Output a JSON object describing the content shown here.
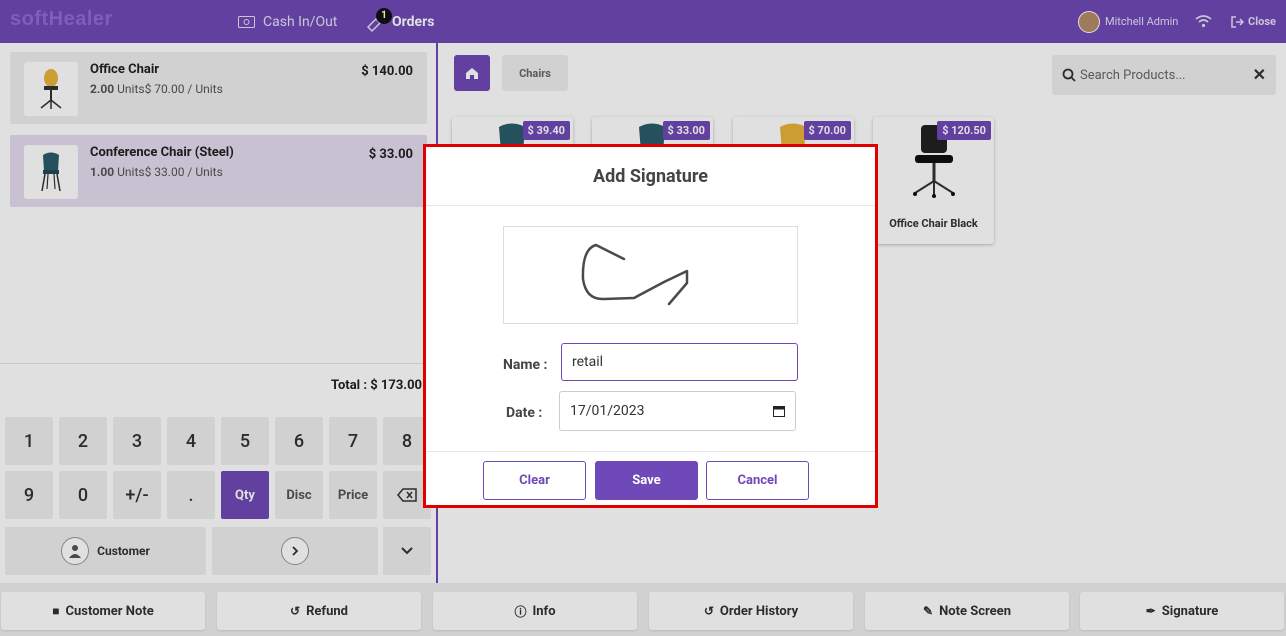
{
  "topbar": {
    "logo": "softHealer",
    "cash_label": "Cash In/Out",
    "orders_label": "Orders",
    "orders_count": "1",
    "user_name": "Mitchell Admin",
    "close_label": "Close"
  },
  "order": {
    "lines": [
      {
        "name": "Office Chair",
        "qty": "2.00",
        "unit_info": "Units$ 70.00 / Units",
        "price": "$ 140.00"
      },
      {
        "name": "Conference Chair (Steel)",
        "qty": "1.00",
        "unit_info": "Units$ 33.00 / Units",
        "price": "$ 33.00"
      }
    ],
    "total": "Total : $ 173.00"
  },
  "numpad": {
    "keys": [
      "1",
      "2",
      "3",
      "4",
      "5",
      "6",
      "7",
      "8",
      "9",
      "0",
      "+/-",
      ".",
      "Qty",
      "Disc",
      "Price"
    ],
    "customer_label": "Customer"
  },
  "products": {
    "breadcrumb": "Chairs",
    "search_placeholder": "Search Products...",
    "items": [
      {
        "price": "$ 39.40",
        "name": ""
      },
      {
        "price": "$ 33.00",
        "name": ""
      },
      {
        "price": "$ 70.00",
        "name": ""
      },
      {
        "price": "$ 120.50",
        "name": "Office Chair Black"
      }
    ]
  },
  "bottom_buttons": {
    "customer_note": "Customer Note",
    "refund": "Refund",
    "info": "Info",
    "order_history": "Order History",
    "note_screen": "Note Screen",
    "signature": "Signature"
  },
  "modal": {
    "title": "Add Signature",
    "name_label": "Name :",
    "name_value": "retail",
    "date_label": "Date :",
    "date_value": "17/01/2023",
    "clear_label": "Clear",
    "save_label": "Save",
    "cancel_label": "Cancel"
  },
  "colors": {
    "accent": "#6f49b7",
    "highlight_border": "#e10000"
  }
}
